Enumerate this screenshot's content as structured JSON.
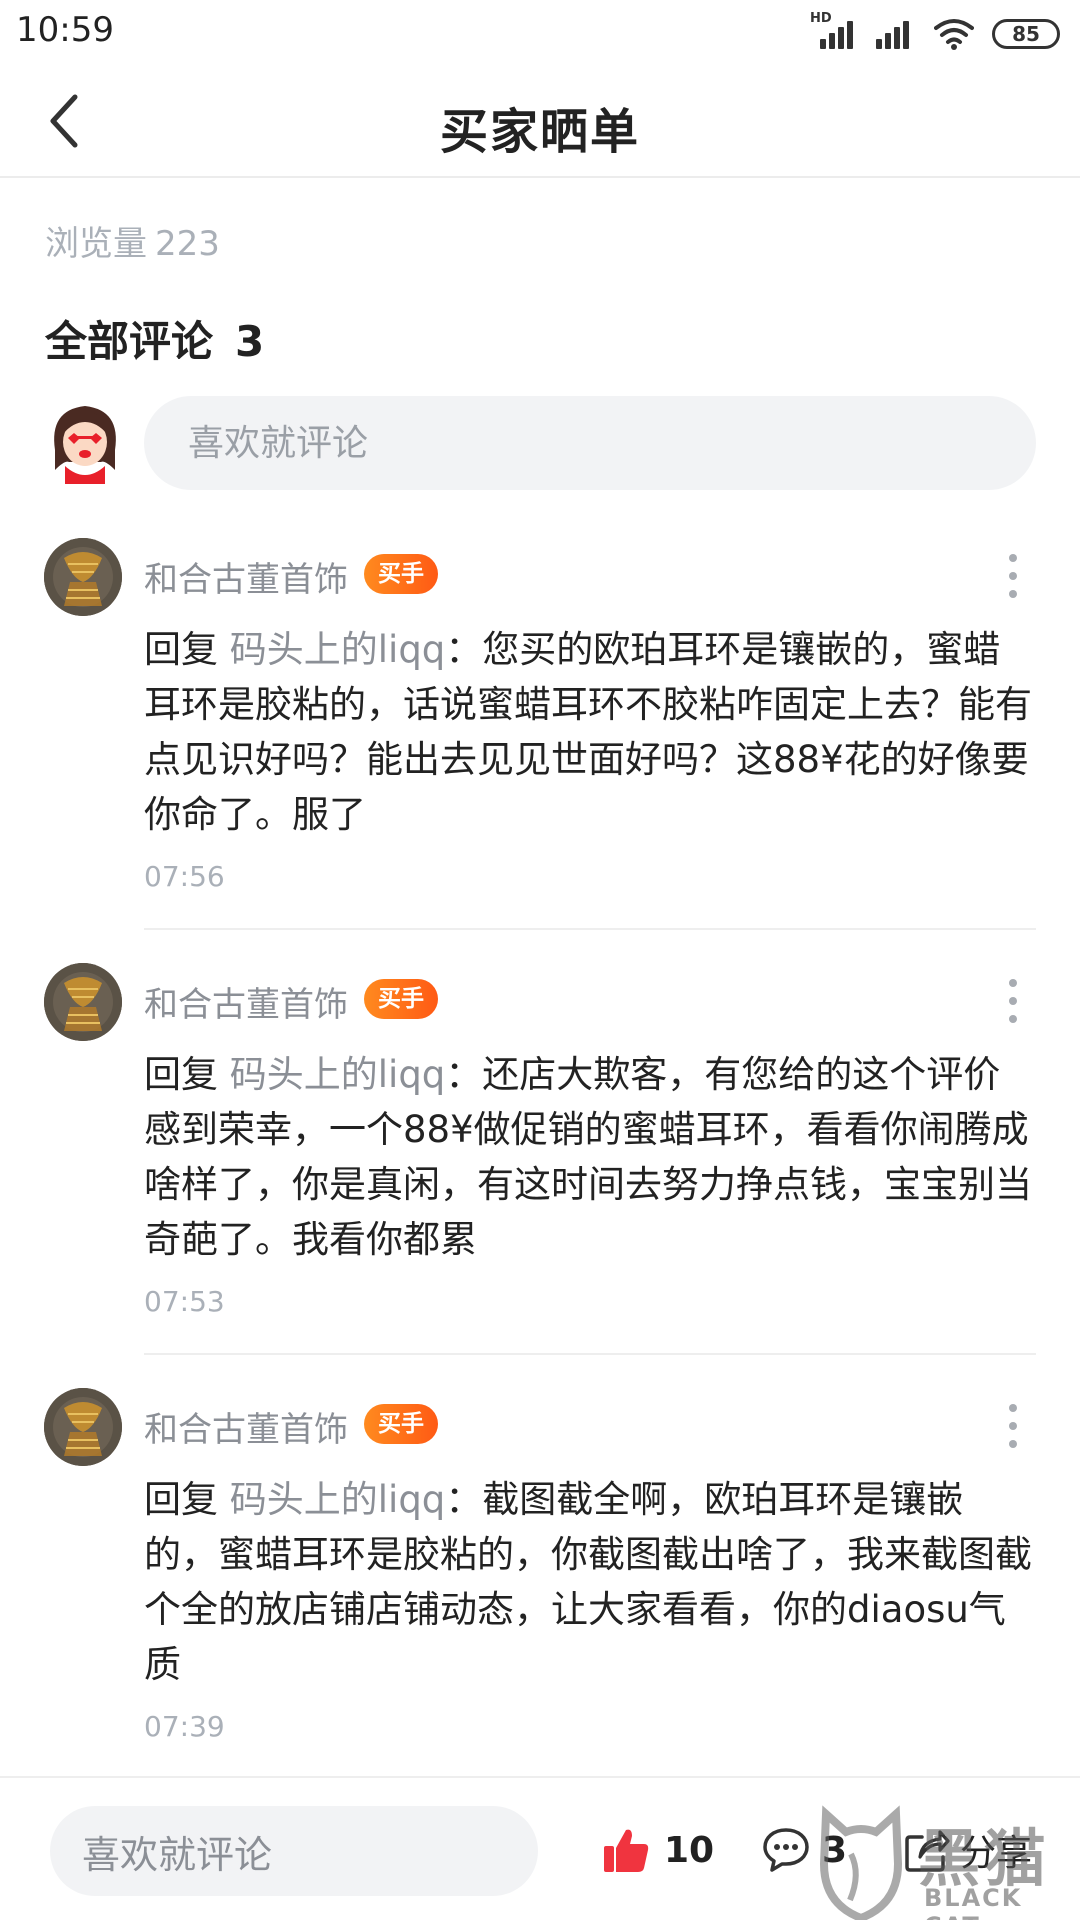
{
  "status_bar": {
    "time": "10:59",
    "network_label": "HD",
    "battery": "85"
  },
  "header": {
    "title": "买家晒单",
    "back_icon": "chevron-left-icon"
  },
  "stats": {
    "views_label": "浏览量",
    "views_value": "223"
  },
  "comments_section": {
    "heading": "全部评论",
    "count": "3",
    "input_placeholder": "喜欢就评论"
  },
  "comments": [
    {
      "username": "和合古董首饰",
      "badge": "买手",
      "reply_prefix": "回复 ",
      "reply_to": "码头上的liqq",
      "text": "：您买的欧珀耳环是镶嵌的，蜜蜡耳环是胶粘的，话说蜜蜡耳环不胶粘咋固定上去？能有点见识好吗？能出去见见世面好吗？这88¥花的好像要你命了。服了",
      "time": "07:56"
    },
    {
      "username": "和合古董首饰",
      "badge": "买手",
      "reply_prefix": "回复 ",
      "reply_to": "码头上的liqq",
      "text": "：还店大欺客，有您给的这个评价感到荣幸，一个88¥做促销的蜜蜡耳环，看看你闹腾成啥样了，你是真闲，有这时间去努力挣点钱，宝宝别当奇葩了。我看你都累",
      "time": "07:53"
    },
    {
      "username": "和合古董首饰",
      "badge": "买手",
      "reply_prefix": "回复 ",
      "reply_to": "码头上的liqq",
      "text": "：截图截全啊，欧珀耳环是镶嵌的，蜜蜡耳环是胶粘的，你截图截出啥了，我来截图截个全的放店铺店铺动态，让大家看看，你的diaosu气质",
      "time": "07:39"
    }
  ],
  "bottom_bar": {
    "input_placeholder": "喜欢就评论",
    "likes": "10",
    "comments": "3",
    "share_label": "分享"
  },
  "watermark": {
    "cn": "黑猫",
    "en": "BLACK CAT"
  },
  "colors": {
    "badge": "#ff6a16",
    "like": "#f0343f",
    "muted_text": "#8b8f96"
  }
}
